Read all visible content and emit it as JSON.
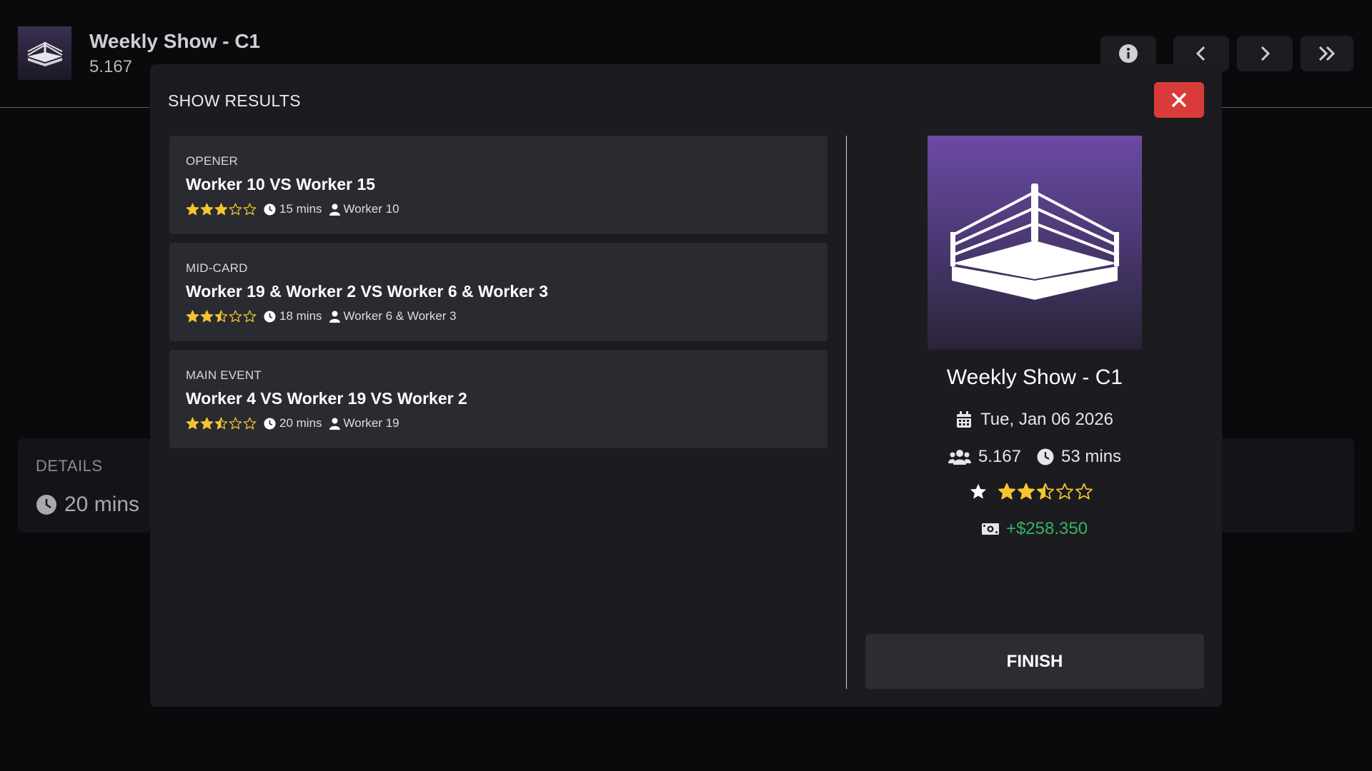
{
  "header": {
    "title": "Weekly Show - C1",
    "subtitle": "5.167",
    "buttons": [
      "info-icon",
      "chevron-left-icon",
      "chevron-right-icon",
      "double-chevron-right-icon"
    ]
  },
  "details": {
    "label": "DETAILS",
    "duration": "20 mins"
  },
  "modal": {
    "title": "SHOW RESULTS",
    "finish_label": "FINISH",
    "matches": [
      {
        "type": "OPENER",
        "name": "Worker 10 VS Worker 15",
        "rating": 3,
        "duration": "15 mins",
        "winner": "Worker 10"
      },
      {
        "type": "MID-CARD",
        "name": "Worker 19 & Worker 2 VS Worker 6 & Worker 3",
        "rating": 2.5,
        "duration": "18 mins",
        "winner": "Worker 6 & Worker 3"
      },
      {
        "type": "MAIN EVENT",
        "name": "Worker 4 VS Worker 19 VS Worker 2",
        "rating": 2.5,
        "duration": "20 mins",
        "winner": "Worker 19"
      }
    ],
    "summary": {
      "show_name": "Weekly Show - C1",
      "date": "Tue, Jan 06 2026",
      "attendance": "5.167",
      "duration": "53 mins",
      "rating": 2.5,
      "revenue": "+$258.350"
    }
  },
  "colors": {
    "star": "#f5c431",
    "close_button": "#d93b3b",
    "revenue": "#3bb15a",
    "card": "#2a2b31"
  }
}
